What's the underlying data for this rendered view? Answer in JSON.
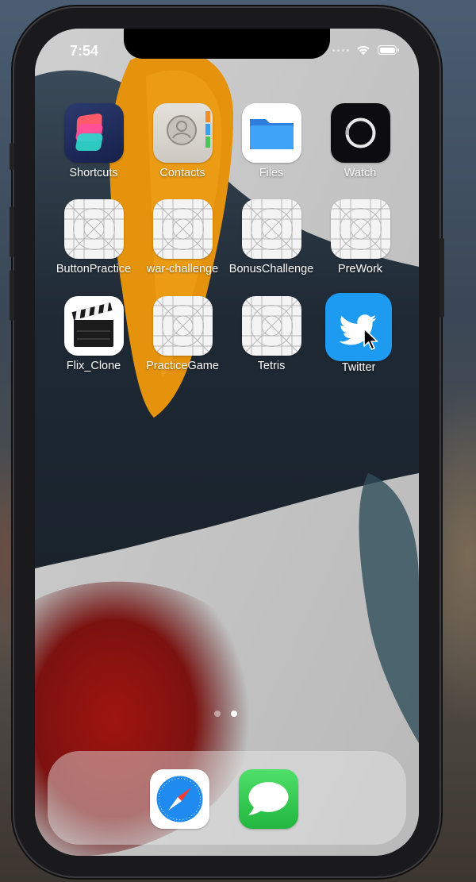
{
  "status_bar": {
    "time": "7:54"
  },
  "apps": [
    {
      "name": "Shortcuts",
      "icon": "shortcuts-icon"
    },
    {
      "name": "Contacts",
      "icon": "contacts-icon"
    },
    {
      "name": "Files",
      "icon": "files-folder-icon"
    },
    {
      "name": "Watch",
      "icon": "watch-icon"
    },
    {
      "name": "ButtonPractice",
      "icon": "blank-app-grid-icon"
    },
    {
      "name": "war-challenge",
      "icon": "blank-app-grid-icon"
    },
    {
      "name": "BonusChallenge",
      "icon": "blank-app-grid-icon"
    },
    {
      "name": "PreWork",
      "icon": "blank-app-grid-icon"
    },
    {
      "name": "Flix_Clone",
      "icon": "clapperboard-icon"
    },
    {
      "name": "PracticeGame",
      "icon": "blank-app-grid-icon"
    },
    {
      "name": "Tetris",
      "icon": "blank-app-grid-icon"
    },
    {
      "name": "Twitter",
      "icon": "twitter-bird-icon"
    }
  ],
  "page_indicator": {
    "pages": 2,
    "current": 2
  },
  "dock": [
    {
      "name": "Safari",
      "icon": "safari-compass-icon"
    },
    {
      "name": "Messages",
      "icon": "messages-bubble-icon"
    }
  ],
  "colors": {
    "twitter_blue": "#1d9bf0",
    "files_blue": "#2f9af5",
    "messages_green": "#2ec94b",
    "safari_blue": "#1f8bf0",
    "wallpaper_orange": "#e8920d",
    "wallpaper_navy": "#1f2a36",
    "wallpaper_red": "#8c1412"
  }
}
